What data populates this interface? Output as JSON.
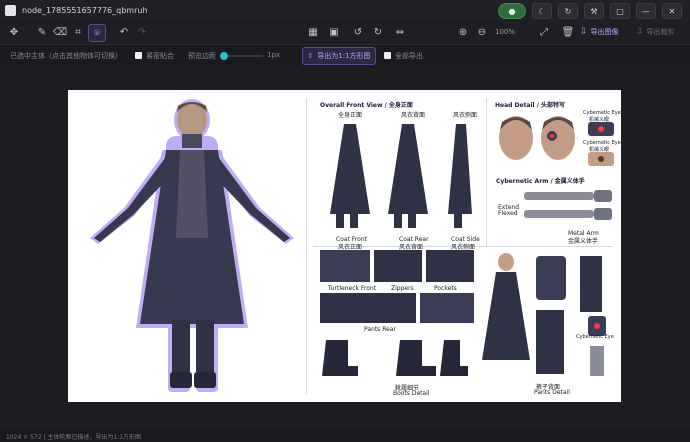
{
  "window": {
    "title": "node_1785551657776_qbmruh"
  },
  "titlebar_right": {
    "pill": "●",
    "btn1": "⟳",
    "btn2": "↻",
    "btn3": "⚒",
    "btn4": "□",
    "btn5": "—",
    "btn6": "✕"
  },
  "toolbar": {
    "zoom": "100%",
    "export_image_label": "导出图像",
    "export_crop_label": "导出裁剪"
  },
  "options": {
    "selected_subject_hint": "已选中主体（点击其他物体可切换）",
    "tight_fit_label": "紧密贴合",
    "preview_margin_label": "预览边距",
    "margin_value": "1px",
    "export_ratio_button": "导出为1:1方形图",
    "export_all_label": "全部导出"
  },
  "sheet": {
    "front_title": "Overall Front View / 全身正面",
    "front_sub1": "全身正面",
    "front_sub2": "风衣背面",
    "front_sub3": "风衣侧面",
    "coat_front": "Coat Front",
    "coat_front_cn": "风衣正面",
    "coat_rear": "Coat Rear",
    "coat_rear_cn": "风衣背面",
    "coat_side": "Coat Side",
    "coat_side_cn": "风衣侧面",
    "head_title": "Head Detail / 头部特写",
    "cyber_eye": "Cybernetic Eye",
    "cyber_eye_cn": "机械义眼",
    "cyber_eye2": "Cybernetic Eye",
    "cyber_eye2_cn": "机械义眼",
    "arm_title": "Cybernetic Arm / 金属义体手",
    "extend": "Extend",
    "flexed": "Flexed",
    "metal_arm": "Metal Arm",
    "metal_arm_cn": "金属义体手",
    "turtleneck": "Turtleneck Front",
    "zippers": "Zippers",
    "pockets": "Pockets",
    "pants_rear": "Pants Rear",
    "boots_cn": "靴履细节",
    "boots": "Boots Detail",
    "pants_cn": "裤子背面",
    "pants": "Pants Detail",
    "cyber_eye3": "Cybernetic Eye"
  },
  "status": {
    "text": "1024 × 572  |  主体轮廓已描述，导出为1:1方形图"
  },
  "colors": {
    "accent": "#8b6cf0",
    "cyan": "#27c4d8",
    "green": "#3f8a4c",
    "bg": "#1c1d21"
  }
}
